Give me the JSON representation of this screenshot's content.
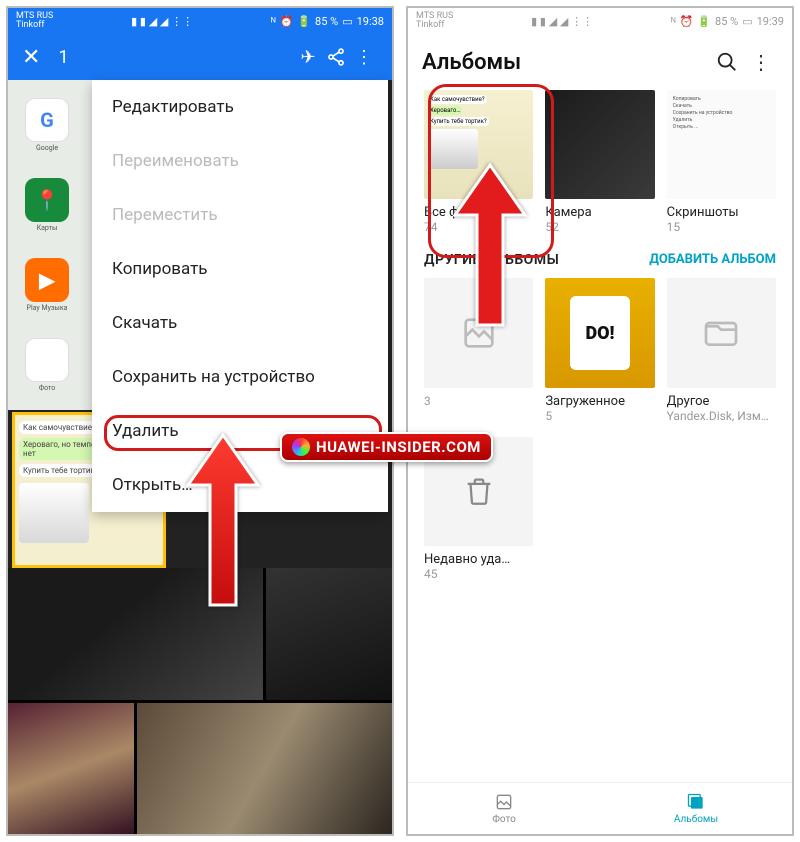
{
  "statusbar": {
    "carrier1": "MTS RUS",
    "carrier2": "Tinkoff",
    "battery": "85 %",
    "time_left": "19:38",
    "time_right": "19:39"
  },
  "left": {
    "selected_count": "1",
    "menu": {
      "edit": "Редактировать",
      "rename": "Переименовать",
      "move": "Переместить",
      "copy": "Копировать",
      "download": "Скачать",
      "save_device": "Сохранить на устройство",
      "delete": "Удалить",
      "open": "Открыть…"
    },
    "apps": {
      "google": "Google",
      "maps": "Карты",
      "play_music": "Play Музыка",
      "photos": "Фото"
    },
    "chat": {
      "q1": "Как самочувствие?",
      "q2": "Купить тебе тортик?"
    }
  },
  "right": {
    "title": "Альбомы",
    "albums": [
      {
        "name": "Все фото",
        "count": "74"
      },
      {
        "name": "Камера",
        "count": "52"
      },
      {
        "name": "Скриншоты",
        "count": "15"
      }
    ],
    "section_title": "ДРУГИЕ АЛЬБОМЫ",
    "add_album": "ДОБАВИТЬ АЛЬБОМ",
    "others": [
      {
        "name": "",
        "count": "3"
      },
      {
        "name": "Загруженное",
        "count": "5"
      },
      {
        "name": "Другое",
        "count": "Yandex.Disk, Изм…"
      }
    ],
    "trash": {
      "name": "Недавно уда…",
      "count": "45"
    },
    "nav": {
      "photos": "Фото",
      "albums": "Альбомы"
    },
    "screens_menu": [
      "Копировать",
      "Скачать",
      "Сохранить на устройство",
      "Удалить",
      "Открыть ..."
    ]
  },
  "watermark": "HUAWEI-INSIDER.COM"
}
